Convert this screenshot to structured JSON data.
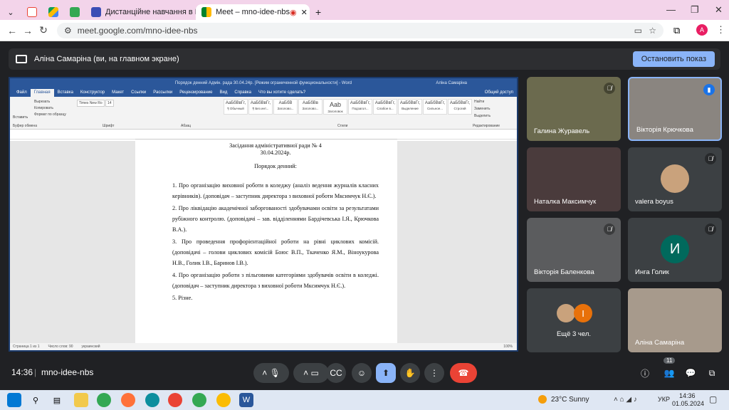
{
  "browser": {
    "tabs": [
      {
        "label": "",
        "icon": "gmail-icon"
      },
      {
        "label": "",
        "icon": "drive-icon"
      },
      {
        "label": "",
        "icon": "app-icon"
      },
      {
        "label": "Дистанційне навчання в ВСП",
        "icon": "moodle-icon"
      },
      {
        "label": "Meet – mno-idee-nbs",
        "icon": "meet-icon",
        "active": true
      }
    ],
    "url": "meet.google.com/mno-idee-nbs",
    "profile_initial": "A"
  },
  "presenting": {
    "label": "Аліна Самаріна (ви, на главном экране)",
    "stop_button": "Остановить показ"
  },
  "word": {
    "title": "Порядок денний Адмін. рада 30.04.24р. [Режим ограниченной функциональности] - Word",
    "user": "Аліна Самаріна",
    "menu": [
      "Файл",
      "Главная",
      "Вставка",
      "Конструктор",
      "Макет",
      "Ссылки",
      "Рассылки",
      "Рецензирование",
      "Вид",
      "Справка",
      "Что вы хотите сделать?"
    ],
    "share": "Общий доступ",
    "clipboard": [
      "Вставить",
      "Вырезать",
      "Копировать",
      "Формат по образцу"
    ],
    "font": "Times New Ro",
    "font_size": "14",
    "group_labels": [
      "Буфер обмена",
      "Шрифт",
      "Абзац",
      "Стили",
      "Редактирование"
    ],
    "styles": [
      {
        "preview": "АаБбВвГг,",
        "name": "¶ Обычный"
      },
      {
        "preview": "АаБбВвГг,",
        "name": "¶ Без инт..."
      },
      {
        "preview": "АаБбВ",
        "name": "Заголово..."
      },
      {
        "preview": "АаБбВв",
        "name": "Заголово..."
      },
      {
        "preview": "Aab",
        "name": "Заголовок"
      },
      {
        "preview": "АаБбВвГг,",
        "name": "Подзагол..."
      },
      {
        "preview": "АаБбВвГг,",
        "name": "Слабое в..."
      },
      {
        "preview": "АаБбВвГг,",
        "name": "Выделение"
      },
      {
        "preview": "АаБбВвГг,",
        "name": "Сильное..."
      },
      {
        "preview": "АаБбВвГг,",
        "name": "Строгий"
      }
    ],
    "editing": [
      "Найти",
      "Заменить",
      "Выделить"
    ],
    "document": {
      "heading": "Засідання адміністративної ради № 4",
      "date": "30.04.2024р.",
      "subheading": "Порядок денний:",
      "items": [
        "1. Про організацію виховної роботи в коледжу (аналіз ведення журналів класних керівників). (доповідач – заступник директора з виховної роботи Мксимчук Н.Є.).",
        "2. Про ліквідацію академічної заборгованості здобувачами освіти за результатами рубіжного контролю. (доповідачі – зав. відділеннями Бардічевська І.Я., Крючкова В.А.).",
        "3. Про проведення профорієнтаційної роботи на рівні циклових комісій. (доповідачі – голови циклових комісій Боюс В.П., Ткаченко Я.М., Віноукурова Н.В., Голик І.В., Баринов І.В.).",
        "4. Про організацію роботи з пільговими категоріями здобувачів освіти в коледжі. (доповідач – заступник директора з виховної роботи Мксимчук Н.Є.).",
        "5. Різне."
      ]
    },
    "status": [
      "Страница 1 из 1",
      "Число слов: 90",
      "украинский"
    ],
    "zoom": "100%"
  },
  "participants": [
    {
      "name": "Галина Журавель",
      "muted": true,
      "type": "video"
    },
    {
      "name": "Вікторія Крючкова",
      "muted": false,
      "speaking": true,
      "type": "video"
    },
    {
      "name": "Наталка Максимчук",
      "muted": false,
      "type": "video"
    },
    {
      "name": "valera boyus",
      "muted": true,
      "type": "photo"
    },
    {
      "name": "Вікторія Баленкова",
      "muted": true,
      "type": "video"
    },
    {
      "name": "Инга Голик",
      "muted": true,
      "type": "letter",
      "initial": "И",
      "color": "#00695c"
    },
    {
      "name": "Ещё 3 чел.",
      "type": "more",
      "initial": "I",
      "color": "#e8710a"
    },
    {
      "name": "Аліна Самаріна",
      "type": "video"
    }
  ],
  "meeting": {
    "time": "14:36",
    "code": "mno-idee-nbs",
    "participant_count": "11"
  },
  "taskbar": {
    "weather": "23°C  Sunny",
    "lang": "УКР",
    "time": "14:36",
    "date": "01.05.2024"
  },
  "colors": {
    "accent": "#8ab4f8",
    "hangup": "#ea4335",
    "word_blue": "#2b579a"
  }
}
